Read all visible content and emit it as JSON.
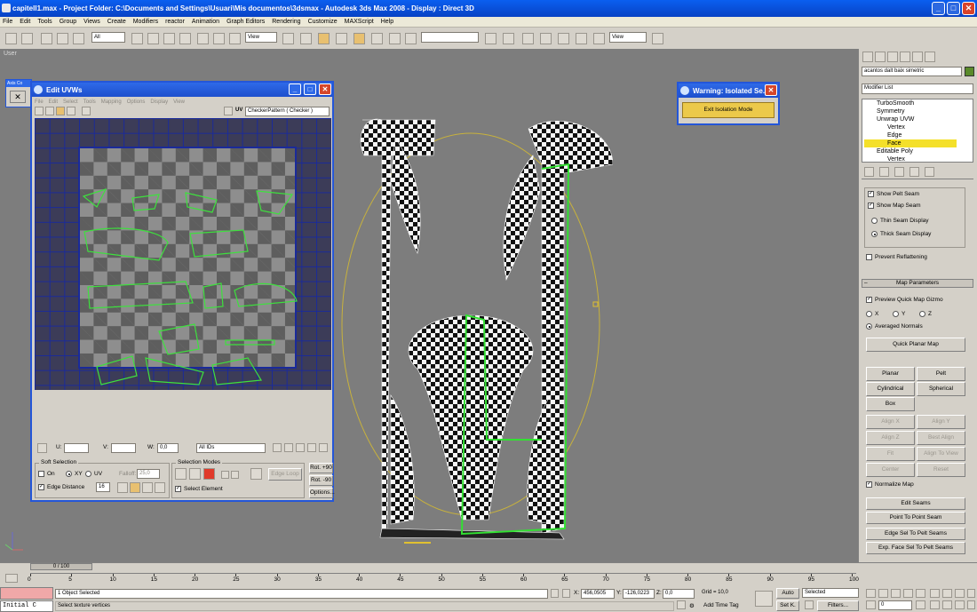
{
  "app": {
    "title": "capitell1.max  - Project Folder: C:\\Documents and Settings\\Usuari\\Mis documentos\\3dsmax    - Autodesk 3ds Max 2008      - Display : Direct 3D"
  },
  "menu": [
    "File",
    "Edit",
    "Tools",
    "Group",
    "Views",
    "Create",
    "Modifiers",
    "reactor",
    "Animation",
    "Graph Editors",
    "Rendering",
    "Customize",
    "MAXScript",
    "Help"
  ],
  "toolbar": {
    "selection_filter": "All",
    "ref_coord": "View",
    "ref_coord2": "View"
  },
  "viewport": {
    "label": "User",
    "axis_label": "Axis Co"
  },
  "uv_editor": {
    "title": "Edit UVWs",
    "menu": [
      "File",
      "Edit",
      "Select",
      "Tools",
      "Mapping",
      "Options",
      "Display",
      "View"
    ],
    "uv_label": "UV",
    "texture": "CheckerPattern  ( Checker )",
    "u_label": "U:",
    "v_label": "V:",
    "w_label": "W:",
    "w_value": "0,0",
    "ids": "All IDs",
    "soft_selection": {
      "title": "Soft Selection",
      "on": "On",
      "xy": "XY",
      "uv": "UV",
      "falloff_label": "Falloff:",
      "falloff": "25,0",
      "edge_distance": "Edge Distance",
      "edge_value": "16"
    },
    "selection_modes": {
      "title": "Selection Modes",
      "select_element": "Select Element",
      "edge_loop": "Edge Loop"
    },
    "rot_p90": "Rot. +90",
    "rot_m90": "Rot. -90",
    "options": "Options..."
  },
  "warning": {
    "title": "Warning: Isolated Se...",
    "button": "Exit Isolation Mode"
  },
  "command_panel": {
    "object_name": "acantos dalt baix simetric",
    "modifier_list": "Modifier List",
    "stack": [
      {
        "label": "TurboSmooth",
        "selected": false,
        "indent": 0
      },
      {
        "label": "Symmetry",
        "selected": false,
        "indent": 0
      },
      {
        "label": "Unwrap UVW",
        "selected": false,
        "indent": 0
      },
      {
        "label": "Vertex",
        "selected": false,
        "indent": 1
      },
      {
        "label": "Edge",
        "selected": false,
        "indent": 1
      },
      {
        "label": "Face",
        "selected": true,
        "indent": 1
      },
      {
        "label": "Editable Poly",
        "selected": false,
        "indent": 0
      },
      {
        "label": "Vertex",
        "selected": false,
        "indent": 1
      }
    ],
    "show_pelt_seam": "Show Pelt Seam",
    "show_map_seam": "Show Map Seam",
    "thin_seam": "Thin Seam Display",
    "thick_seam": "Thick Seam Display",
    "prevent": "Prevent Reflattening",
    "map_params": "Map Parameters",
    "preview_gizmo": "Preview Quick Map Gizmo",
    "axis_x": "X",
    "axis_y": "Y",
    "axis_z": "Z",
    "averaged": "Averaged Normals",
    "quick_planar": "Quick Planar Map",
    "planar": "Planar",
    "pelt": "Pelt",
    "cylindrical": "Cylindrical",
    "spherical": "Spherical",
    "box": "Box",
    "align_x": "Align X",
    "align_y": "Align Y",
    "align_z": "Align Z",
    "best_align": "Best Align",
    "fit": "Fit",
    "align_view": "Align To View",
    "center": "Center",
    "reset": "Reset",
    "normalize": "Normalize Map",
    "edit_seams": "Edit Seams",
    "point_to_point": "Point To Point Seam",
    "edge_sel": "Edge Sel To Pelt Seams",
    "exp_face": "Exp. Face Sel To Pelt Seams"
  },
  "timeline": {
    "frame": "0 / 100",
    "ticks": [
      "0",
      "5",
      "10",
      "15",
      "20",
      "25",
      "30",
      "35",
      "40",
      "45",
      "50",
      "55",
      "60",
      "65",
      "70",
      "75",
      "80",
      "85",
      "90",
      "95",
      "100"
    ],
    "status1": "1 Object Selected",
    "status2": "Select texture vertices",
    "x_label": "X:",
    "x_val": "456,0505",
    "y_label": "Y:",
    "y_val": "-126,0223",
    "z_label": "Z:",
    "z_val": "0,0",
    "grid": "Grid = 10,0",
    "add_time_tag": "Add Time Tag",
    "auto": "Auto",
    "selected": "Selected",
    "setk": "Set K.",
    "filters": "Filters...",
    "frame_no": "0",
    "initial": "Initial C"
  }
}
